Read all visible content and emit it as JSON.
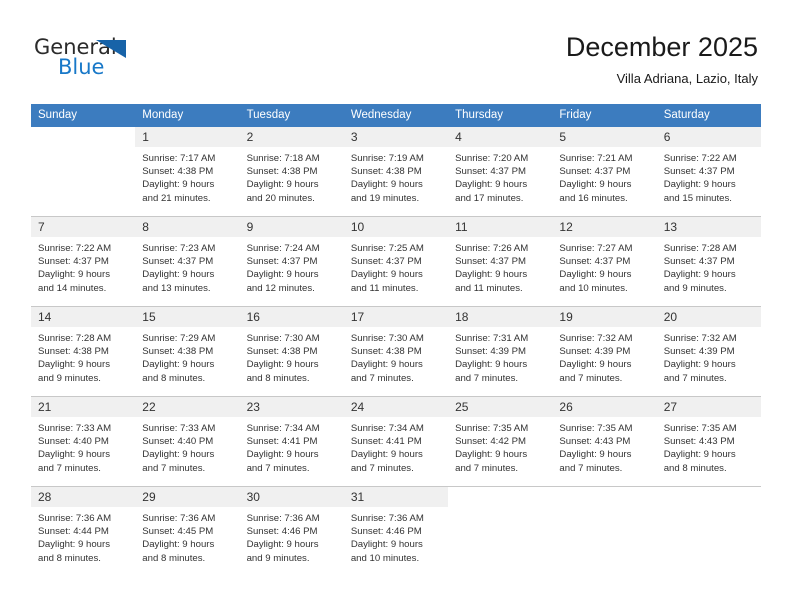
{
  "brand": {
    "name_part1": "General",
    "name_part2": "Blue",
    "triangle_color": "#1763a8",
    "blue_color": "#1878c8"
  },
  "header": {
    "title": "December 2025",
    "subtitle": "Villa Adriana, Lazio, Italy"
  },
  "theme": {
    "header_row_bg": "#3c7cbf",
    "daynum_bg": "#f0f0f0",
    "grid_line": "#c8c8c8"
  },
  "weekdays": [
    "Sunday",
    "Monday",
    "Tuesday",
    "Wednesday",
    "Thursday",
    "Friday",
    "Saturday"
  ],
  "weeks": [
    [
      {
        "day": "",
        "sunrise": "",
        "sunset": "",
        "daylight1": "",
        "daylight2": ""
      },
      {
        "day": "1",
        "sunrise": "Sunrise: 7:17 AM",
        "sunset": "Sunset: 4:38 PM",
        "daylight1": "Daylight: 9 hours",
        "daylight2": "and 21 minutes."
      },
      {
        "day": "2",
        "sunrise": "Sunrise: 7:18 AM",
        "sunset": "Sunset: 4:38 PM",
        "daylight1": "Daylight: 9 hours",
        "daylight2": "and 20 minutes."
      },
      {
        "day": "3",
        "sunrise": "Sunrise: 7:19 AM",
        "sunset": "Sunset: 4:38 PM",
        "daylight1": "Daylight: 9 hours",
        "daylight2": "and 19 minutes."
      },
      {
        "day": "4",
        "sunrise": "Sunrise: 7:20 AM",
        "sunset": "Sunset: 4:37 PM",
        "daylight1": "Daylight: 9 hours",
        "daylight2": "and 17 minutes."
      },
      {
        "day": "5",
        "sunrise": "Sunrise: 7:21 AM",
        "sunset": "Sunset: 4:37 PM",
        "daylight1": "Daylight: 9 hours",
        "daylight2": "and 16 minutes."
      },
      {
        "day": "6",
        "sunrise": "Sunrise: 7:22 AM",
        "sunset": "Sunset: 4:37 PM",
        "daylight1": "Daylight: 9 hours",
        "daylight2": "and 15 minutes."
      }
    ],
    [
      {
        "day": "7",
        "sunrise": "Sunrise: 7:22 AM",
        "sunset": "Sunset: 4:37 PM",
        "daylight1": "Daylight: 9 hours",
        "daylight2": "and 14 minutes."
      },
      {
        "day": "8",
        "sunrise": "Sunrise: 7:23 AM",
        "sunset": "Sunset: 4:37 PM",
        "daylight1": "Daylight: 9 hours",
        "daylight2": "and 13 minutes."
      },
      {
        "day": "9",
        "sunrise": "Sunrise: 7:24 AM",
        "sunset": "Sunset: 4:37 PM",
        "daylight1": "Daylight: 9 hours",
        "daylight2": "and 12 minutes."
      },
      {
        "day": "10",
        "sunrise": "Sunrise: 7:25 AM",
        "sunset": "Sunset: 4:37 PM",
        "daylight1": "Daylight: 9 hours",
        "daylight2": "and 11 minutes."
      },
      {
        "day": "11",
        "sunrise": "Sunrise: 7:26 AM",
        "sunset": "Sunset: 4:37 PM",
        "daylight1": "Daylight: 9 hours",
        "daylight2": "and 11 minutes."
      },
      {
        "day": "12",
        "sunrise": "Sunrise: 7:27 AM",
        "sunset": "Sunset: 4:37 PM",
        "daylight1": "Daylight: 9 hours",
        "daylight2": "and 10 minutes."
      },
      {
        "day": "13",
        "sunrise": "Sunrise: 7:28 AM",
        "sunset": "Sunset: 4:37 PM",
        "daylight1": "Daylight: 9 hours",
        "daylight2": "and 9 minutes."
      }
    ],
    [
      {
        "day": "14",
        "sunrise": "Sunrise: 7:28 AM",
        "sunset": "Sunset: 4:38 PM",
        "daylight1": "Daylight: 9 hours",
        "daylight2": "and 9 minutes."
      },
      {
        "day": "15",
        "sunrise": "Sunrise: 7:29 AM",
        "sunset": "Sunset: 4:38 PM",
        "daylight1": "Daylight: 9 hours",
        "daylight2": "and 8 minutes."
      },
      {
        "day": "16",
        "sunrise": "Sunrise: 7:30 AM",
        "sunset": "Sunset: 4:38 PM",
        "daylight1": "Daylight: 9 hours",
        "daylight2": "and 8 minutes."
      },
      {
        "day": "17",
        "sunrise": "Sunrise: 7:30 AM",
        "sunset": "Sunset: 4:38 PM",
        "daylight1": "Daylight: 9 hours",
        "daylight2": "and 7 minutes."
      },
      {
        "day": "18",
        "sunrise": "Sunrise: 7:31 AM",
        "sunset": "Sunset: 4:39 PM",
        "daylight1": "Daylight: 9 hours",
        "daylight2": "and 7 minutes."
      },
      {
        "day": "19",
        "sunrise": "Sunrise: 7:32 AM",
        "sunset": "Sunset: 4:39 PM",
        "daylight1": "Daylight: 9 hours",
        "daylight2": "and 7 minutes."
      },
      {
        "day": "20",
        "sunrise": "Sunrise: 7:32 AM",
        "sunset": "Sunset: 4:39 PM",
        "daylight1": "Daylight: 9 hours",
        "daylight2": "and 7 minutes."
      }
    ],
    [
      {
        "day": "21",
        "sunrise": "Sunrise: 7:33 AM",
        "sunset": "Sunset: 4:40 PM",
        "daylight1": "Daylight: 9 hours",
        "daylight2": "and 7 minutes."
      },
      {
        "day": "22",
        "sunrise": "Sunrise: 7:33 AM",
        "sunset": "Sunset: 4:40 PM",
        "daylight1": "Daylight: 9 hours",
        "daylight2": "and 7 minutes."
      },
      {
        "day": "23",
        "sunrise": "Sunrise: 7:34 AM",
        "sunset": "Sunset: 4:41 PM",
        "daylight1": "Daylight: 9 hours",
        "daylight2": "and 7 minutes."
      },
      {
        "day": "24",
        "sunrise": "Sunrise: 7:34 AM",
        "sunset": "Sunset: 4:41 PM",
        "daylight1": "Daylight: 9 hours",
        "daylight2": "and 7 minutes."
      },
      {
        "day": "25",
        "sunrise": "Sunrise: 7:35 AM",
        "sunset": "Sunset: 4:42 PM",
        "daylight1": "Daylight: 9 hours",
        "daylight2": "and 7 minutes."
      },
      {
        "day": "26",
        "sunrise": "Sunrise: 7:35 AM",
        "sunset": "Sunset: 4:43 PM",
        "daylight1": "Daylight: 9 hours",
        "daylight2": "and 7 minutes."
      },
      {
        "day": "27",
        "sunrise": "Sunrise: 7:35 AM",
        "sunset": "Sunset: 4:43 PM",
        "daylight1": "Daylight: 9 hours",
        "daylight2": "and 8 minutes."
      }
    ],
    [
      {
        "day": "28",
        "sunrise": "Sunrise: 7:36 AM",
        "sunset": "Sunset: 4:44 PM",
        "daylight1": "Daylight: 9 hours",
        "daylight2": "and 8 minutes."
      },
      {
        "day": "29",
        "sunrise": "Sunrise: 7:36 AM",
        "sunset": "Sunset: 4:45 PM",
        "daylight1": "Daylight: 9 hours",
        "daylight2": "and 8 minutes."
      },
      {
        "day": "30",
        "sunrise": "Sunrise: 7:36 AM",
        "sunset": "Sunset: 4:46 PM",
        "daylight1": "Daylight: 9 hours",
        "daylight2": "and 9 minutes."
      },
      {
        "day": "31",
        "sunrise": "Sunrise: 7:36 AM",
        "sunset": "Sunset: 4:46 PM",
        "daylight1": "Daylight: 9 hours",
        "daylight2": "and 10 minutes."
      },
      {
        "day": "",
        "sunrise": "",
        "sunset": "",
        "daylight1": "",
        "daylight2": ""
      },
      {
        "day": "",
        "sunrise": "",
        "sunset": "",
        "daylight1": "",
        "daylight2": ""
      },
      {
        "day": "",
        "sunrise": "",
        "sunset": "",
        "daylight1": "",
        "daylight2": ""
      }
    ]
  ]
}
